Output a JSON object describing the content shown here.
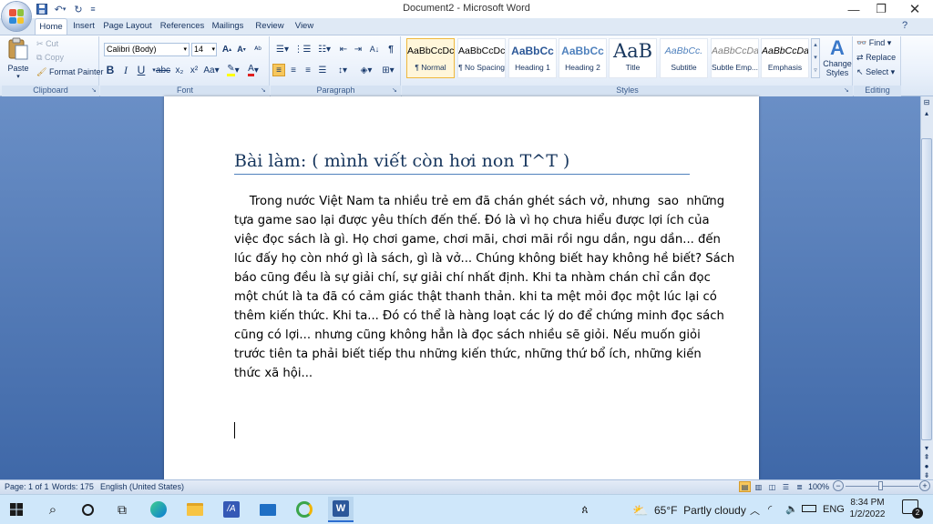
{
  "app": {
    "window_title": "Document2 - Microsoft Word"
  },
  "tabs": [
    "Home",
    "Insert",
    "Page Layout",
    "References",
    "Mailings",
    "Review",
    "View"
  ],
  "clipboard": {
    "paste": "Paste",
    "cut": "Cut",
    "copy": "Copy",
    "format_painter": "Format Painter",
    "group": "Clipboard"
  },
  "font": {
    "name": "Calibri (Body)",
    "size": "14",
    "group": "Font"
  },
  "paragraph": {
    "group": "Paragraph"
  },
  "styles": {
    "group": "Styles",
    "items": [
      {
        "preview": "AaBbCcDc",
        "label": "¶ Normal"
      },
      {
        "preview": "AaBbCcDc",
        "label": "¶ No Spacing"
      },
      {
        "preview": "AaBbCc",
        "label": "Heading 1"
      },
      {
        "preview": "AaBbCc",
        "label": "Heading 2"
      },
      {
        "preview": "AaB",
        "label": "Title"
      },
      {
        "preview": "AaBbCc.",
        "label": "Subtitle"
      },
      {
        "preview": "AaBbCcDa",
        "label": "Subtle Emp..."
      },
      {
        "preview": "AaBbCcDa",
        "label": "Emphasis"
      }
    ],
    "change_styles": [
      "Change",
      "Styles"
    ]
  },
  "editing": {
    "group": "Editing",
    "find": "Find",
    "replace": "Replace",
    "select": "Select"
  },
  "document": {
    "heading": "Bài làm: ( mình viết còn hơi non T^T )",
    "lines": [
      "    Trong nước Việt Nam ta nhiều trẻ em đã chán ghét sách vở, nhưng  sao  những",
      "tựa game sao lại được yêu thích đến thế. Đó là vì họ chưa hiểu được lợi ích của",
      "việc đọc sách là gì. Họ chơi game, chơi mãi, chơi mãi rồi ngu dần, ngu dần... đến",
      "lúc đấy họ còn nhớ gì là sách, gì là vở... Chúng không biết hay không hề biết? Sách",
      "báo cũng đều là sự giải chí, sự giải chí nhất định. Khi ta nhàm chán chỉ cần đọc",
      "một chút là ta đã có cảm giác thật thanh thản. khi ta mệt mỏi đọc một lúc lại có",
      "thêm kiến thức. Khi ta... Đó có thể là hàng loạt các lý do để chứng minh đọc sách",
      "cũng có lợi... nhưng cũng không hẳn là đọc sách nhiều sẽ giỏi. Nếu muốn giỏi",
      "trước tiên ta phải biết tiếp thu những kiến thức, những thứ bổ ích, những kiến",
      "thức xã hội..."
    ]
  },
  "statusbar": {
    "page": "Page: 1 of 1",
    "words": "Words: 175",
    "language": "English (United States)",
    "zoom": "100%"
  },
  "taskbar": {
    "weather": "65°F  Partly cloudy",
    "lang": "ENG",
    "time": "8:34 PM",
    "date": "1/2/2022",
    "notifications": "2"
  }
}
